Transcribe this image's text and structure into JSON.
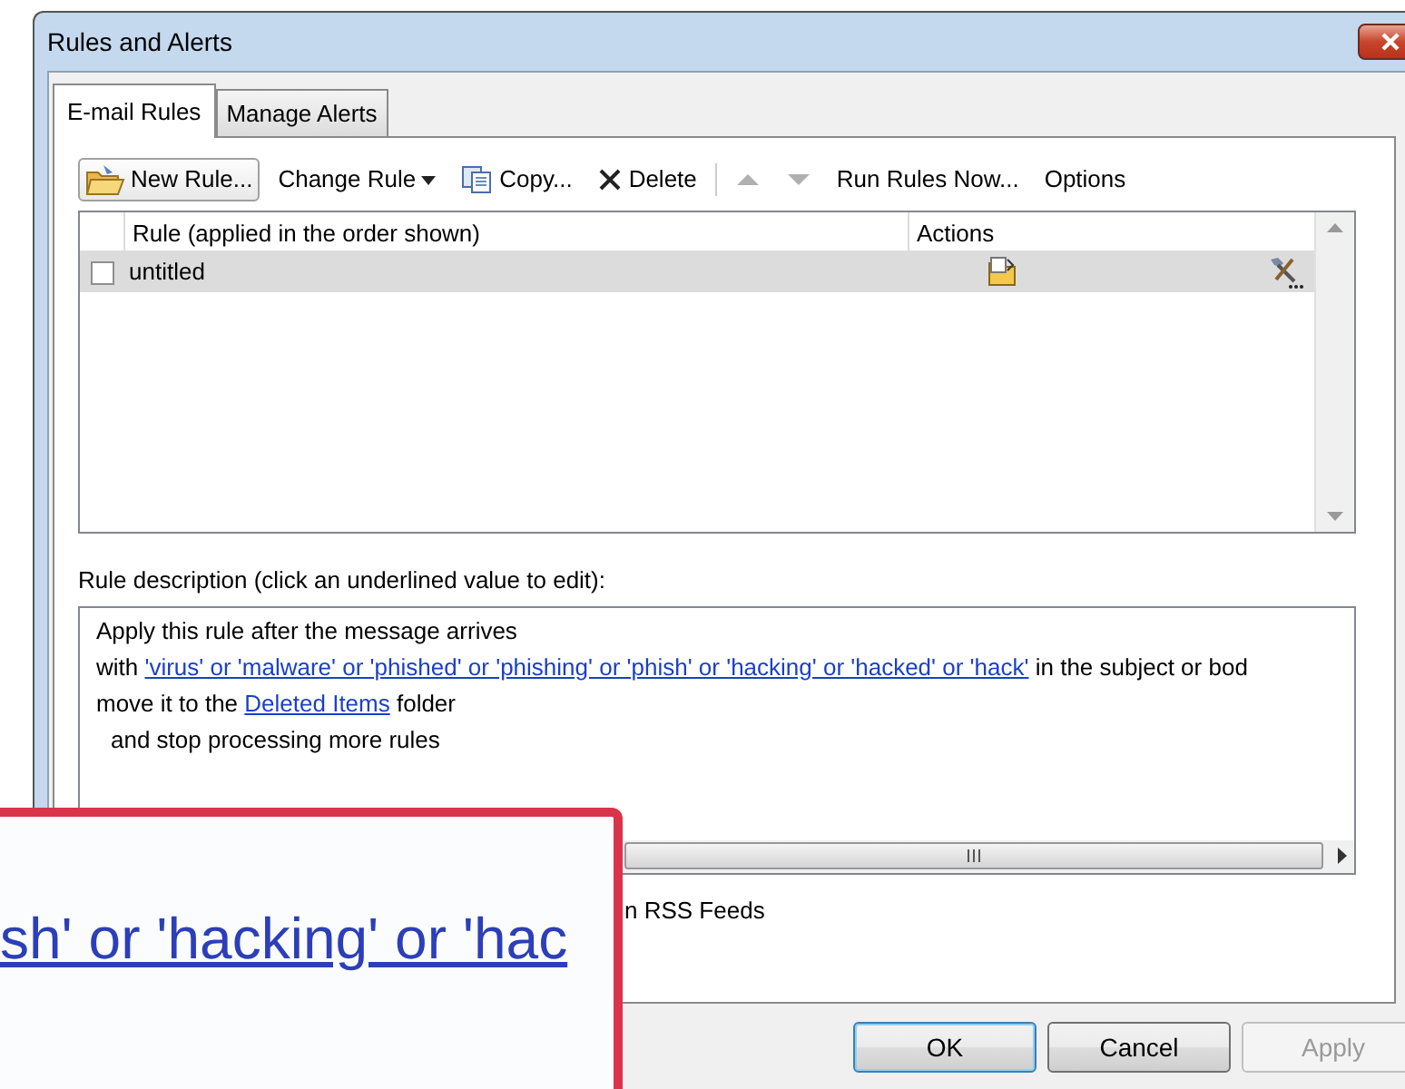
{
  "window": {
    "title": "Rules and Alerts"
  },
  "tabs": [
    {
      "label": "E-mail Rules",
      "selected": true
    },
    {
      "label": "Manage Alerts",
      "selected": false
    }
  ],
  "toolbar": [
    {
      "kind": "new",
      "label": "New Rule...",
      "focused": true,
      "disabled": false
    },
    {
      "kind": "dropdown",
      "label": "Change Rule",
      "focused": false,
      "disabled": false
    },
    {
      "kind": "copy",
      "label": "Copy...",
      "focused": false,
      "disabled": false
    },
    {
      "kind": "delete",
      "label": "Delete",
      "focused": false,
      "disabled": false
    },
    {
      "kind": "separator"
    },
    {
      "kind": "up",
      "focused": false,
      "disabled": true
    },
    {
      "kind": "down",
      "focused": false,
      "disabled": true
    },
    {
      "kind": "text",
      "label": "Run Rules Now...",
      "focused": false,
      "disabled": false
    },
    {
      "kind": "text",
      "label": "Options",
      "focused": false,
      "disabled": false
    }
  ],
  "rules": {
    "columns": [
      "Rule (applied in the order shown)",
      "Actions"
    ],
    "rows": [
      {
        "name": "untitled",
        "checked": false,
        "selected": true
      }
    ]
  },
  "description": {
    "label": "Rule description (click an underlined value to edit):",
    "lines": [
      {
        "indented": false,
        "parts": [
          {
            "text": "Apply this rule after the message arrives",
            "link": false
          }
        ]
      },
      {
        "indented": false,
        "parts": [
          {
            "text": "with ",
            "link": false
          },
          {
            "text": "'virus' or 'malware' or 'phished' or 'phishing' or 'phish' or 'hacking' or 'hacked' or 'hack'",
            "link": true
          },
          {
            "text": " in the subject or bod",
            "link": false
          }
        ]
      },
      {
        "indented": false,
        "parts": [
          {
            "text": "move it to the ",
            "link": false
          },
          {
            "text": "Deleted Items",
            "link": true
          },
          {
            "text": " folder",
            "link": false
          }
        ]
      },
      {
        "indented": true,
        "parts": [
          {
            "text": "and stop processing more rules",
            "link": false
          }
        ]
      }
    ]
  },
  "option_text": "n RSS Feeds",
  "buttons": [
    {
      "label": "OK",
      "default": true,
      "disabled": false
    },
    {
      "label": "Cancel",
      "default": false,
      "disabled": false
    },
    {
      "label": "Apply",
      "default": false,
      "disabled": true
    }
  ],
  "magnifier": {
    "text": "sh' or 'hacking' or 'hac"
  }
}
